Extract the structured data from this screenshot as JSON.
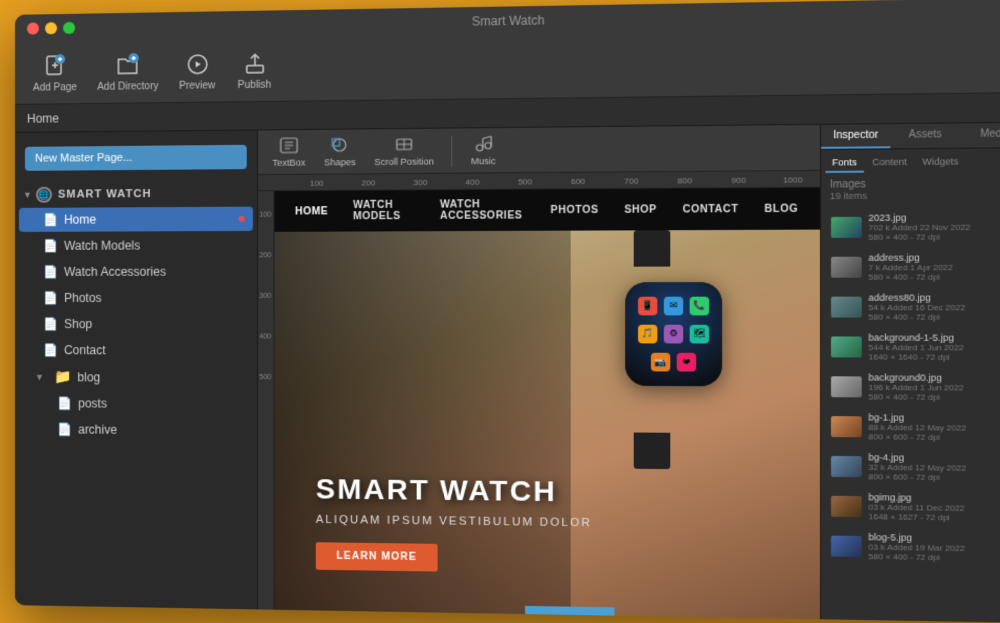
{
  "window": {
    "title": "Smart Watch"
  },
  "toolbar": {
    "add_page_label": "Add Page",
    "add_directory_label": "Add Directory",
    "preview_label": "Preview",
    "publish_label": "Publish",
    "home_label": "Home"
  },
  "canvas_toolbar": {
    "textbox_label": "TextBox",
    "shapes_label": "Shapes",
    "scroll_position_label": "Scroll Position",
    "music_label": "Music"
  },
  "new_master_btn": "New Master Page...",
  "site_name": "SMART WATCH",
  "nav_items": [
    {
      "label": "Home",
      "active": true
    },
    {
      "label": "Watch Models",
      "active": false
    },
    {
      "label": "Watch Accessories",
      "active": false
    },
    {
      "label": "Photos",
      "active": false
    },
    {
      "label": "Shop",
      "active": false
    },
    {
      "label": "Contact",
      "active": false
    }
  ],
  "blog_folder": {
    "label": "blog",
    "children": [
      "posts",
      "archive"
    ]
  },
  "website_nav": [
    "HOME",
    "WATCH MODELS",
    "WATCH ACCESSORIES",
    "PHOTOS",
    "SHOP",
    "CONTACT",
    "BLOG"
  ],
  "hero": {
    "title": "SMART WATCH",
    "subtitle": "ALIQUAM IPSUM VESTIBULUM DOLOR",
    "button_label": "LEARN MORE"
  },
  "right_panel": {
    "tabs": [
      "Inspector",
      "Assets",
      "Media"
    ],
    "subtabs": [
      "Fonts",
      "Content",
      "Widgets"
    ],
    "section_title": "Images",
    "images_count": "19 items",
    "images": [
      {
        "name": "2023.jpg",
        "meta": "702 k   Added 22 Nov 2022   580 × 400 - 72 dpi"
      },
      {
        "name": "address.jpg",
        "meta": "7 k   Added 1 Apr 2022   580 × 400 - 72 dpi"
      },
      {
        "name": "address80.jpg",
        "meta": "54 k   Added 16 Dec 2022   580 × 400 - 72 dpi"
      },
      {
        "name": "background-1-5.jpg",
        "meta": "544 k   Added 1 Jun 2022   1640 × 1640 - 72 dpi"
      },
      {
        "name": "background0.jpg",
        "meta": "196 k   Added 1 Jun 2022   580 × 400 - 72 dpi"
      },
      {
        "name": "bg-1.jpg",
        "meta": "88 k   Added 12 May 2022   800 × 600 - 72 dpi"
      },
      {
        "name": "bg-4.jpg",
        "meta": "32 k   Added 12 May 2022   800 × 600 - 72 dpi"
      },
      {
        "name": "bgimg.jpg",
        "meta": "03 k   Added 11 Dec 2022   1648 × 1627 - 72 dpi"
      },
      {
        "name": "blog-5.jpg",
        "meta": "03 k   Added 19 Mar 2022   580 × 400 - 72 dpi"
      }
    ]
  },
  "ruler": {
    "h_marks": [
      "100",
      "200",
      "300",
      "400",
      "500",
      "600",
      "700",
      "800",
      "900",
      "1000"
    ],
    "v_marks": [
      "100",
      "200",
      "300",
      "400",
      "500"
    ]
  }
}
